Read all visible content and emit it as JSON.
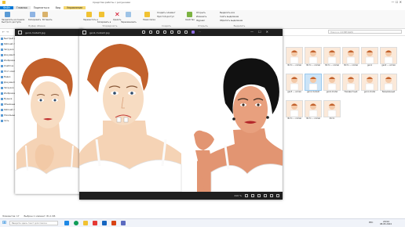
{
  "explorer": {
    "title": "Средства работы с рисунками",
    "tabs": [
      "Файл",
      "Главная",
      "Поделиться",
      "Вид"
    ],
    "context_tab": "Управление",
    "ribbon": {
      "pin_label": "Закрепить на панели быстрого доступа",
      "copy_label": "Копировать",
      "paste_label": "Вставить",
      "move_label": "Переместить в",
      "copy_to_label": "Копировать в",
      "delete_label": "Удалить",
      "rename_label": "Переименовать",
      "new_folder_label": "Новая папка",
      "new_item_label": "Создать элемент",
      "easy_access_label": "Простой доступ",
      "properties_label": "Свойства",
      "open_label": "Открыть",
      "edit_label": "Изменить",
      "history_label": "Журнал",
      "select_all_label": "Выделить все",
      "select_none_label": "Снять выделение",
      "invert_label": "Обратить выделение",
      "groups": [
        "Буфер обмена",
        "Упорядочить",
        "Создать",
        "Открыть",
        "Выделить"
      ]
    },
    "search_placeholder": "Поиск в: СОЗВЕЗДИЯ",
    "nav_items": [
      "Быстрый доступ",
      "Рабочий стол",
      "Загрузки",
      "Документы",
      "Изображения",
      "OneDrive",
      "Этот компьютер",
      "Видео",
      "Документы",
      "Загрузки",
      "Изображения",
      "Музыка",
      "Объемные объекты",
      "Рабочий стол",
      "Локальный диск (C:)",
      "Сеть"
    ],
    "files": [
      {
        "name": "Фото — копия"
      },
      {
        "name": "Фото — копия"
      },
      {
        "name": "Фото — копия"
      },
      {
        "name": "Фото — копия"
      },
      {
        "name": "gen1"
      },
      {
        "name": "gen2 — копия"
      },
      {
        "name": "gen3 — копия"
      },
      {
        "name": "gen1-model2",
        "selected": true
      },
      {
        "name": "gen2-model"
      },
      {
        "name": "Неизвестный"
      },
      {
        "name": "gen1-model"
      },
      {
        "name": "Безымянный"
      },
      {
        "name": "Фото — копия"
      },
      {
        "name": "Фото — копия"
      },
      {
        "name": "Фото"
      }
    ],
    "status": {
      "items_count": "Элементов: 17",
      "selected": "Выбран 1 элемент: 81,1 КБ"
    }
  },
  "viewer_back": {
    "title": "gen1-model3.jpg"
  },
  "viewer_front": {
    "title": "gen1-model2.jpg",
    "zoom": "410 %"
  },
  "taskbar": {
    "search_placeholder": "Введите здесь текст для поиска",
    "time": "20:02",
    "date": "08.05.2024",
    "lang": "РУС"
  },
  "colors": {
    "accent": "#0078d7",
    "context_tab": "#f5d76e",
    "viewer_chrome": "#1f1f1f"
  }
}
